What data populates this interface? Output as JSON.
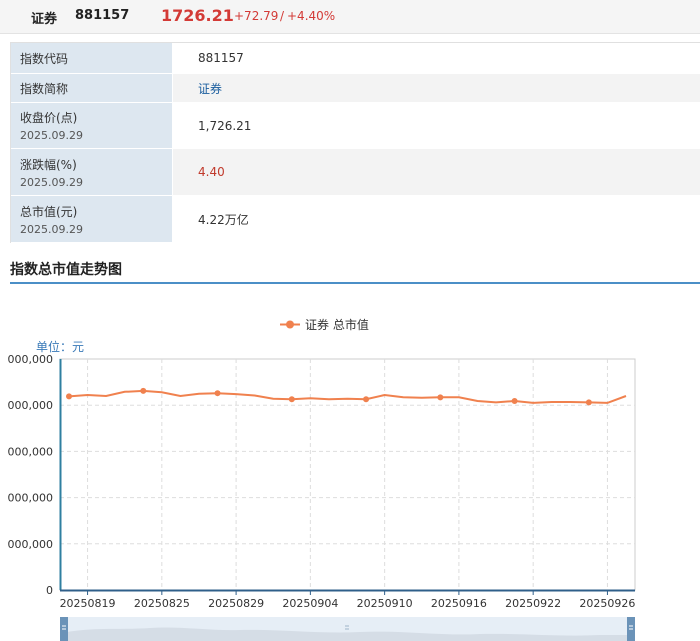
{
  "header": {
    "name": "证券",
    "code": "881157",
    "price": "1726.21",
    "change": "+72.79",
    "separator": "/",
    "change_pct": "+4.40%",
    "up_color": "#d33a36"
  },
  "info": {
    "rows": [
      {
        "label": "指数代码",
        "sub": "",
        "value": "881157"
      },
      {
        "label": "指数简称",
        "sub": "",
        "value": "证券"
      },
      {
        "label": "收盘价(点)",
        "sub": "2025.09.29",
        "value": "1,726.21"
      },
      {
        "label": "涨跌幅(%)",
        "sub": "2025.09.29",
        "value": "4.40"
      },
      {
        "label": "总市值(元)",
        "sub": "2025.09.29",
        "value": "4.22万亿"
      }
    ]
  },
  "section": {
    "title": "指数总市值走势图"
  },
  "chart_data": {
    "type": "line",
    "legend": "证券 总市值",
    "unit_label": "单位：元",
    "line_color": "#f0814e",
    "ylim": [
      0,
      5000
    ],
    "y_tick_labels": [
      "0",
      "000,000",
      "000,000",
      "000,000",
      "000,000",
      "000,000"
    ],
    "x_tick_labels": [
      "20250819",
      "20250825",
      "20250829",
      "20250904",
      "20250910",
      "20250916",
      "20250922",
      "20250926"
    ],
    "x_tick_index": [
      1,
      5,
      9,
      13,
      17,
      21,
      25,
      29
    ],
    "x": [
      "20250818",
      "20250819",
      "20250820",
      "20250821",
      "20250822",
      "20250825",
      "20250826",
      "20250827",
      "20250828",
      "20250829",
      "20250901",
      "20250902",
      "20250903",
      "20250904",
      "20250905",
      "20250908",
      "20250909",
      "20250910",
      "20250911",
      "20250912",
      "20250915",
      "20250916",
      "20250917",
      "20250918",
      "20250919",
      "20250922",
      "20250923",
      "20250924",
      "20250925",
      "20250926",
      "20250929"
    ],
    "values": [
      4190,
      4220,
      4200,
      4290,
      4310,
      4280,
      4200,
      4250,
      4260,
      4240,
      4210,
      4140,
      4130,
      4150,
      4130,
      4140,
      4130,
      4220,
      4170,
      4160,
      4170,
      4170,
      4090,
      4060,
      4090,
      4050,
      4070,
      4070,
      4060,
      4050,
      4200
    ],
    "marker_index": [
      0,
      4,
      8,
      12,
      16,
      20,
      24,
      28
    ]
  },
  "zoom": {
    "handle_color": "#6b93b8"
  }
}
